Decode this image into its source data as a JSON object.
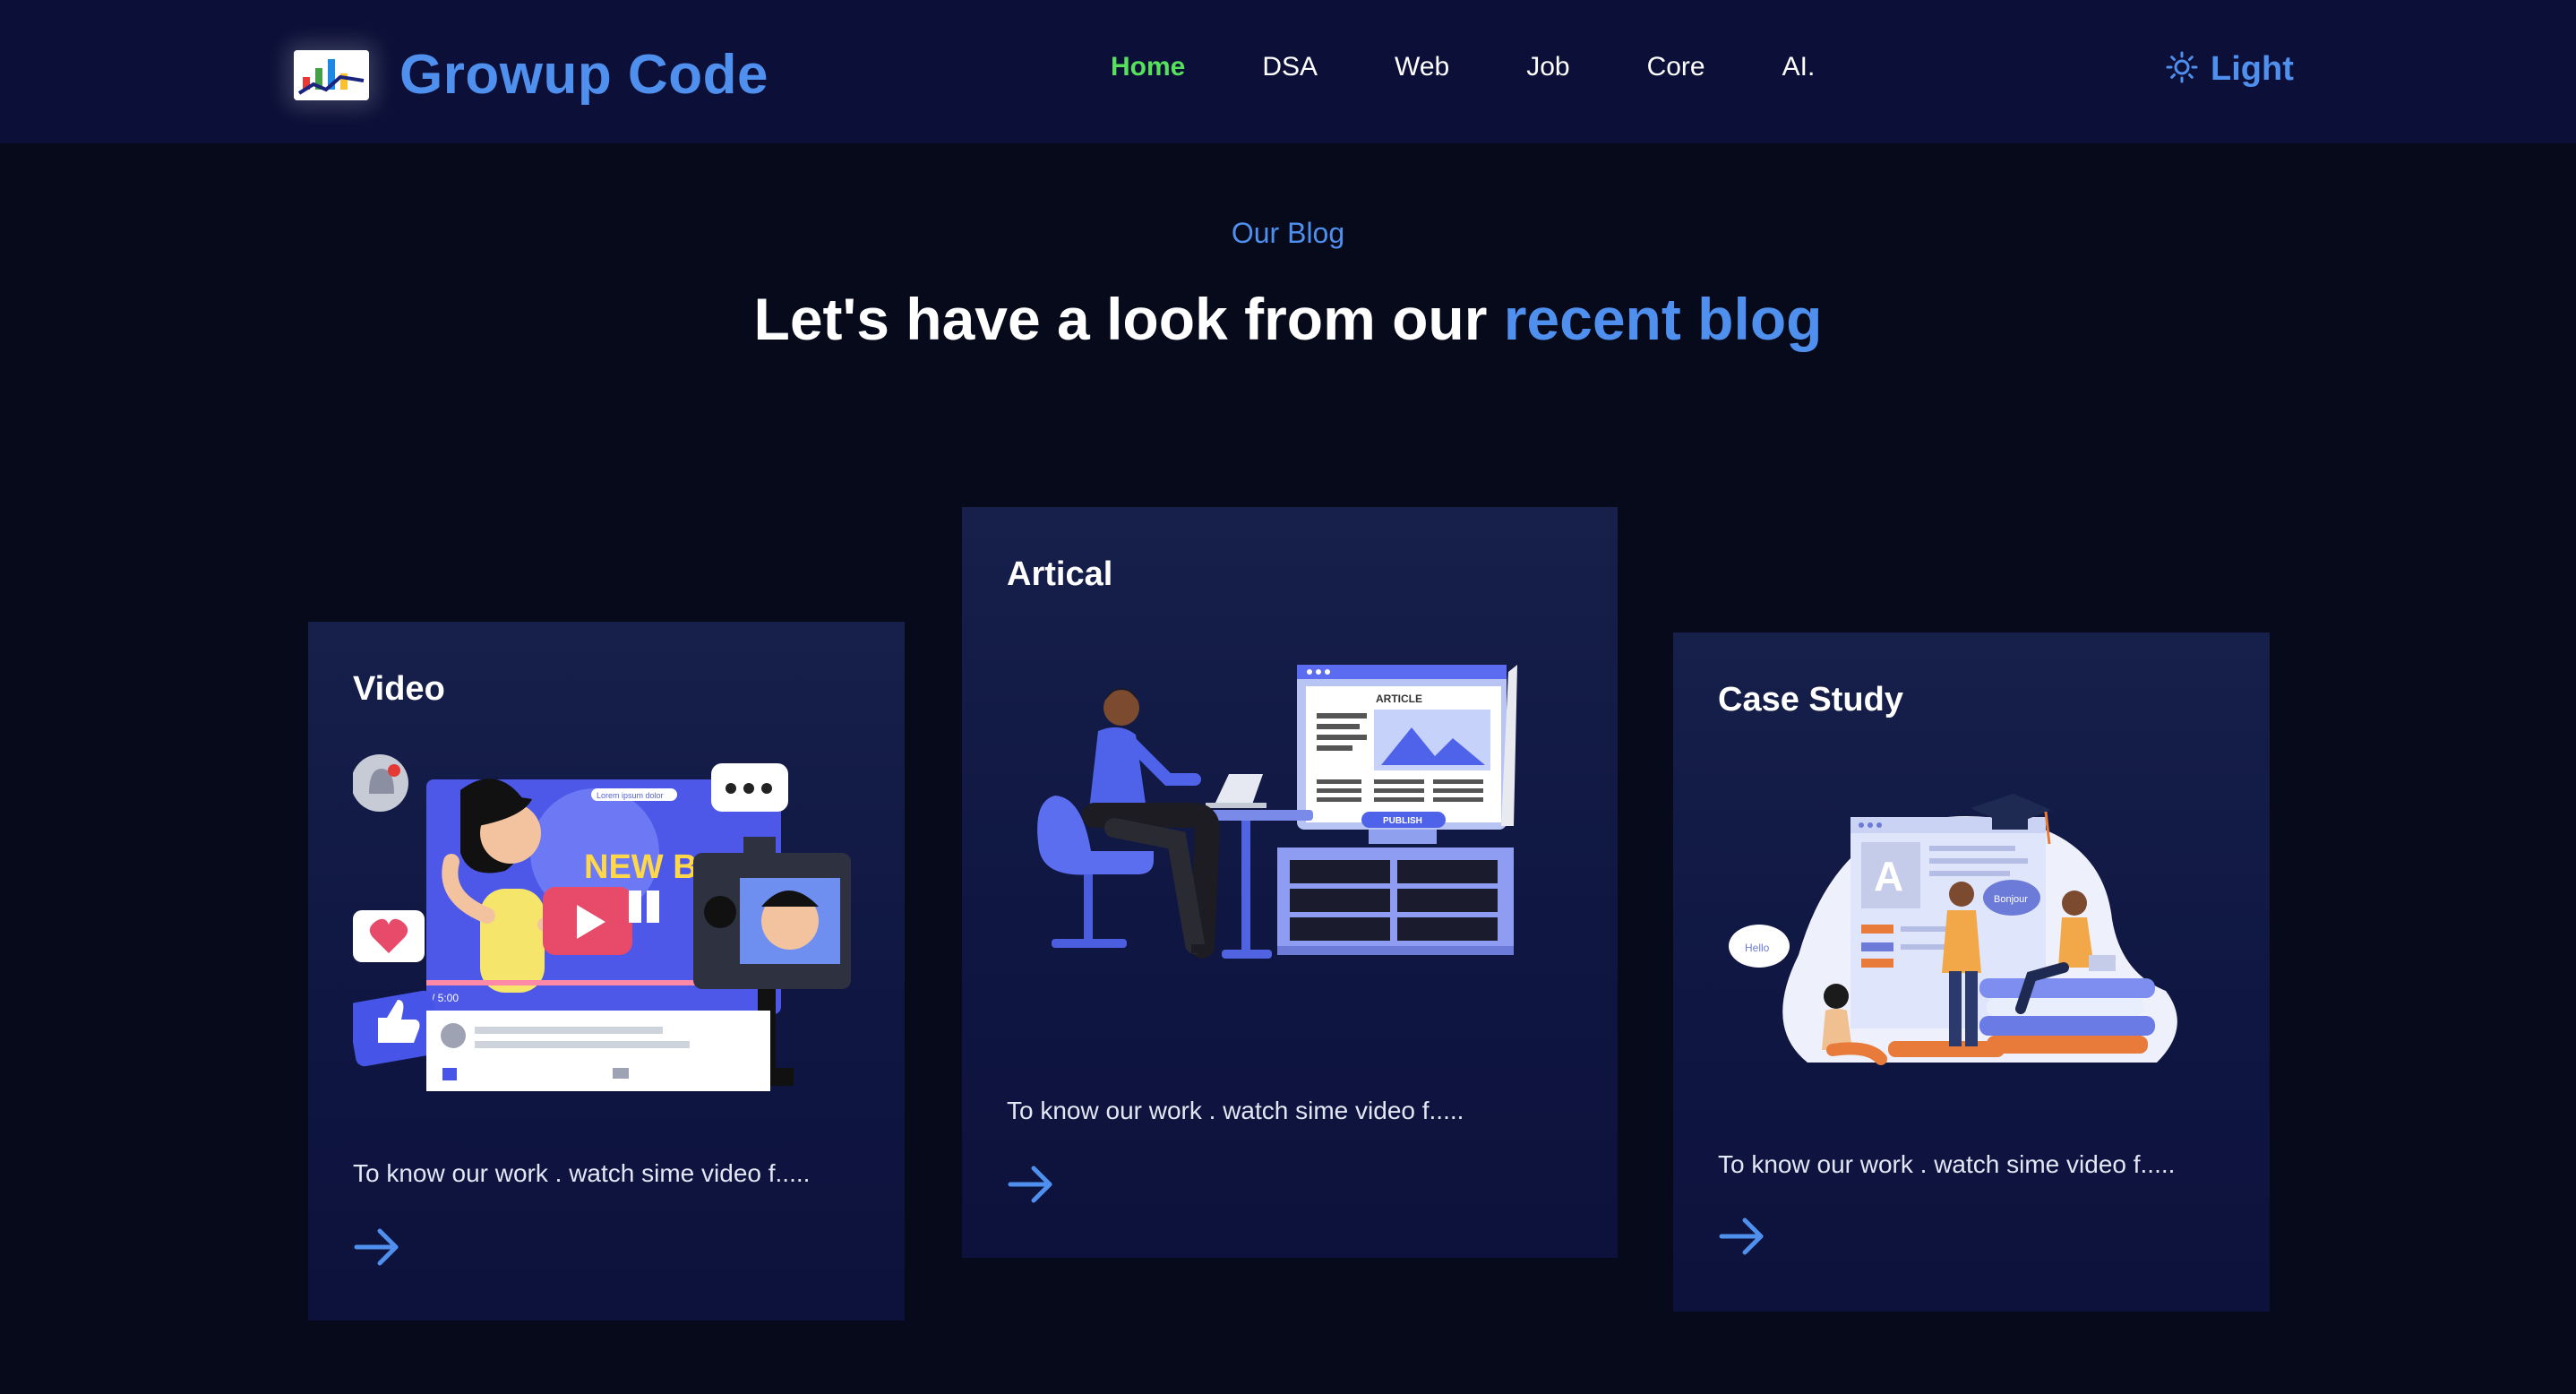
{
  "brand": {
    "name": "Growup Code",
    "logo_icon": "chart-logo-icon"
  },
  "nav": {
    "items": [
      {
        "label": "Home",
        "active": true
      },
      {
        "label": "DSA",
        "active": false
      },
      {
        "label": "Web",
        "active": false
      },
      {
        "label": "Job",
        "active": false
      },
      {
        "label": "Core",
        "active": false
      },
      {
        "label": "AI.",
        "active": false
      }
    ],
    "theme_toggle": {
      "icon": "sun-icon",
      "label": "Light"
    }
  },
  "header": {
    "eyebrow": "Our Blog",
    "headline_prefix": "Let's have a look from our ",
    "headline_accent": "recent blog"
  },
  "cards": [
    {
      "title": "Video",
      "illustration": "video-blog-illustration",
      "illustration_texts": [
        "NEW BLOG",
        "Lorem ipsum dolor",
        "/ 5:00"
      ],
      "description": "To know our work . watch sime video f.....",
      "arrow_icon": "arrow-right-icon"
    },
    {
      "title": "Artical",
      "illustration": "article-publish-illustration",
      "illustration_texts": [
        "ARTICLE",
        "PUBLISH"
      ],
      "description": "To know our work . watch sime video f.....",
      "arrow_icon": "arrow-right-icon"
    },
    {
      "title": "Case Study",
      "illustration": "case-study-illustration",
      "illustration_texts": [
        "Hello",
        "Bonjour"
      ],
      "description": "To know our work . watch sime video f.....",
      "arrow_icon": "arrow-right-icon"
    }
  ],
  "colors": {
    "background": "#060a1a",
    "navbar": "#0c1038",
    "accent": "#4f8fee",
    "active_nav": "#57e05c",
    "card": "#111846"
  }
}
